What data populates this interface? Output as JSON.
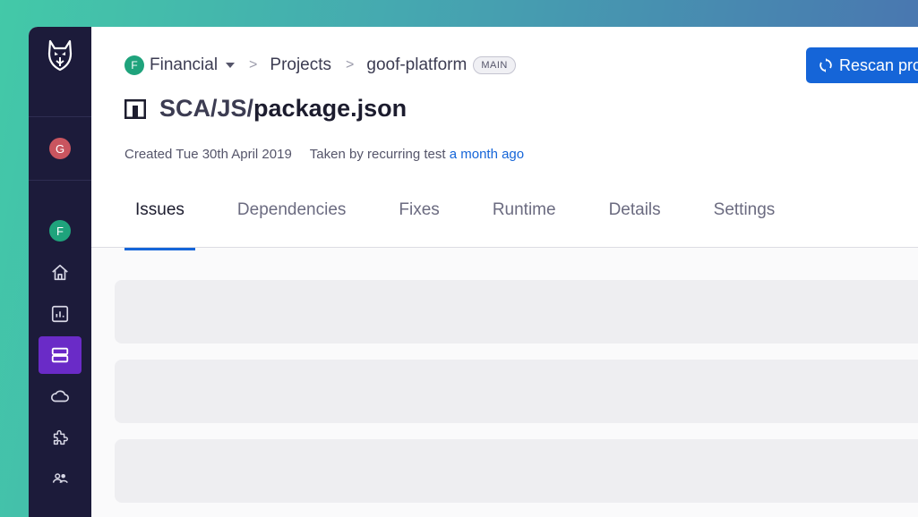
{
  "sidebar": {
    "user_avatar_initial": "G",
    "org_avatar_initial": "F",
    "nav_items": [
      "home-icon",
      "reports-icon",
      "projects-icon",
      "cloud-icon",
      "integrations-icon",
      "members-icon"
    ],
    "active_item": "projects-icon"
  },
  "breadcrumb": {
    "org_initial": "F",
    "org_name": "Financial",
    "projects": "Projects",
    "repo": "goof-platform",
    "branch": "MAIN"
  },
  "actions": {
    "rescan_label": "Rescan project"
  },
  "project": {
    "title_prefix": "SCA/JS/",
    "title_name": "package.json"
  },
  "meta": {
    "created": "Created Tue 30th April 2019",
    "taken_by": "Taken by recurring test",
    "taken_when": "a month ago"
  },
  "tabs": [
    {
      "label": "Issues",
      "active": true
    },
    {
      "label": "Dependencies"
    },
    {
      "label": "Fixes"
    },
    {
      "label": "Runtime"
    },
    {
      "label": "Details"
    },
    {
      "label": "Settings"
    }
  ],
  "colors": {
    "accent": "#1565d8",
    "sidebar": "#1c1b3a",
    "active_nav": "#6a2bc7"
  }
}
